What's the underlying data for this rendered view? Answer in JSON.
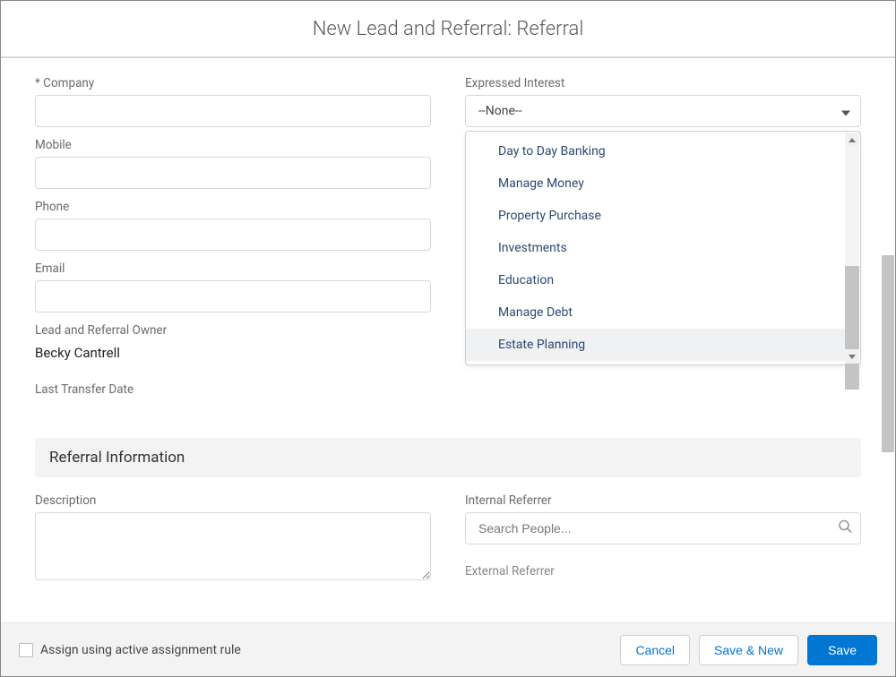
{
  "header": {
    "title": "New Lead and Referral: Referral"
  },
  "form": {
    "company_label": "* Company",
    "mobile_label": "Mobile",
    "phone_label": "Phone",
    "email_label": "Email",
    "owner_label": "Lead and Referral Owner",
    "owner_value": "Becky Cantrell",
    "last_transfer_label": "Last Transfer Date",
    "expressed_interest_label": "Expressed Interest",
    "expressed_interest_value": "--None--",
    "expressed_interest_options": [
      "Day to Day Banking",
      "Manage Money",
      "Property Purchase",
      "Investments",
      "Education",
      "Manage Debt",
      "Estate Planning"
    ],
    "highlighted_option_index": 6
  },
  "referral_section": {
    "heading": "Referral Information",
    "description_label": "Description",
    "internal_referrer_label": "Internal Referrer",
    "internal_referrer_placeholder": "Search People...",
    "external_referrer_label_partial": "External Referrer"
  },
  "footer": {
    "assign_label": "Assign using active assignment rule",
    "cancel": "Cancel",
    "save_new": "Save & New",
    "save": "Save"
  }
}
